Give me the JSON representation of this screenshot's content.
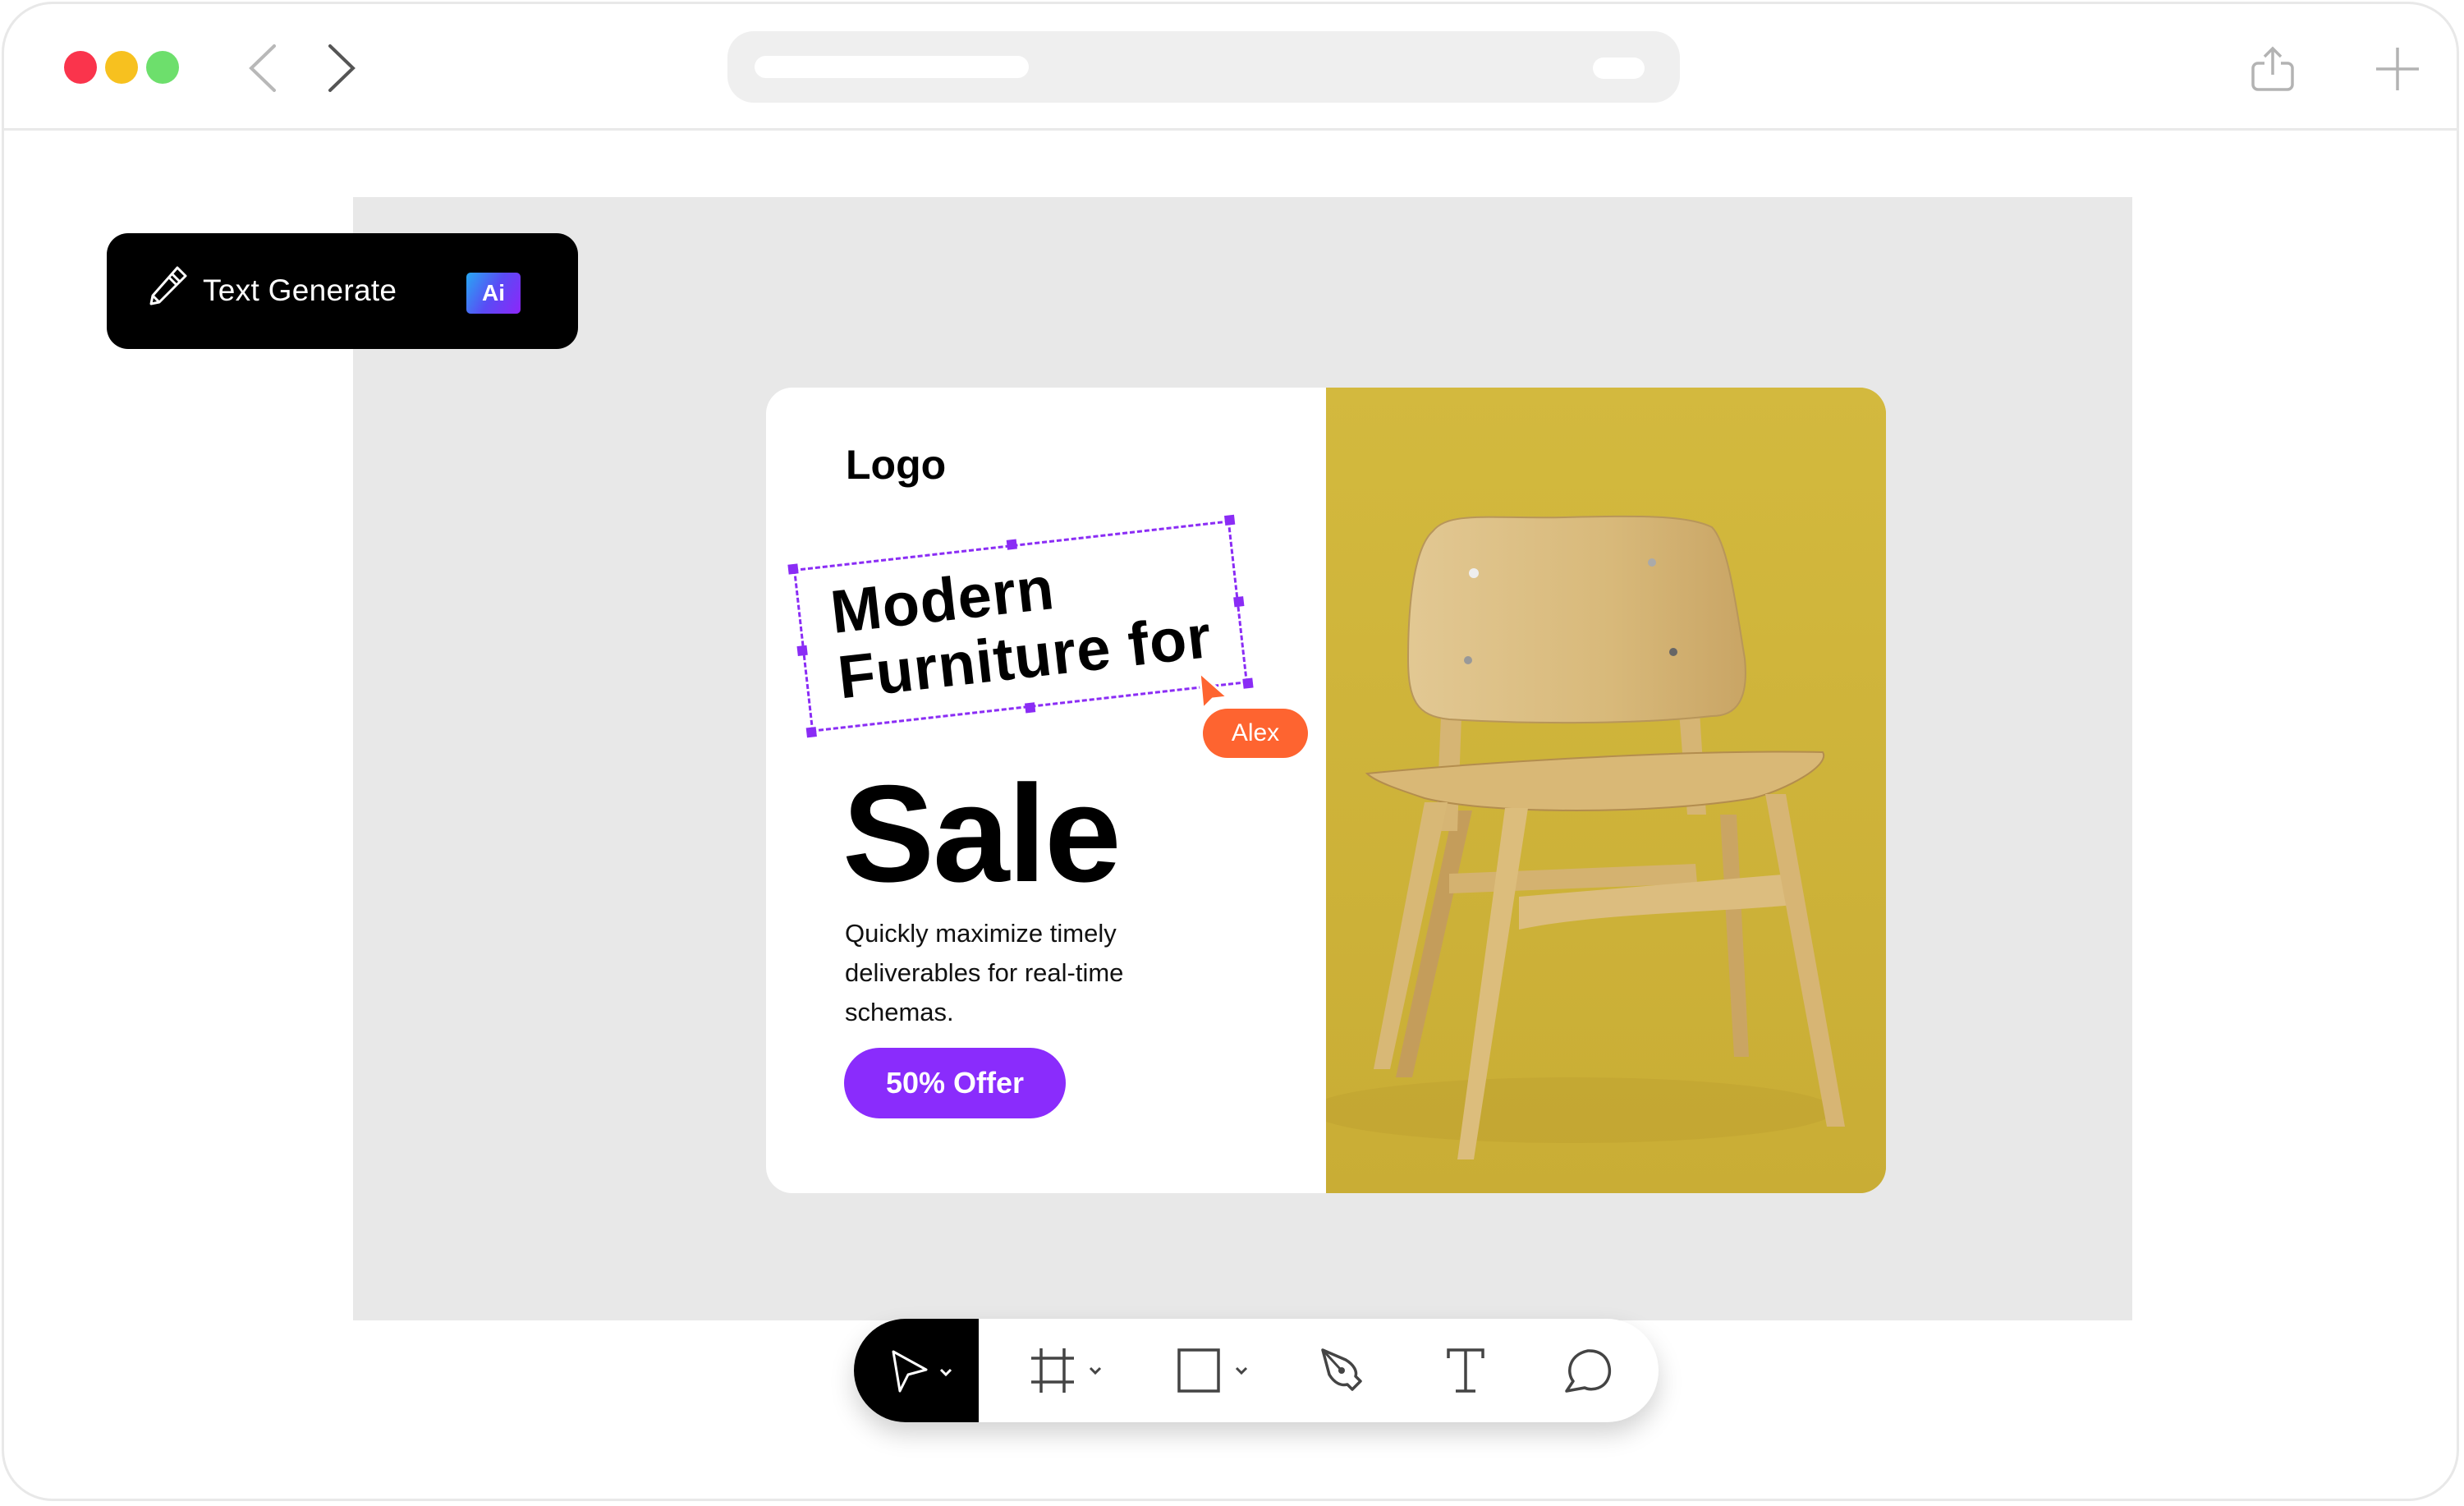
{
  "browser": {
    "traffic_lights": [
      "close",
      "minimize",
      "maximize"
    ],
    "nav": {
      "back_icon": "chevron-left-icon",
      "forward_icon": "chevron-right-icon"
    },
    "actions": [
      "share-icon",
      "new-tab-icon"
    ]
  },
  "ai_chip": {
    "icon": "pencil-icon",
    "label": "Text Generate",
    "badge": "Ai"
  },
  "design": {
    "logo": "Logo",
    "headline": "Modern\nFurniture for",
    "collaborator": "Alex",
    "title": "Sale",
    "body": "Quickly maximize timely deliverables for real-time schemas.",
    "cta": "50% Offer",
    "image": "wooden-chair-on-yellow-background"
  },
  "colors": {
    "selection": "#8a2cf5",
    "collaborator": "#fe6430",
    "cta": "#8a2cfc",
    "photo_bg": "#cfb63a"
  },
  "toolbar": {
    "tools": [
      {
        "name": "move",
        "icon": "pointer-icon",
        "active": true,
        "has_dropdown": true
      },
      {
        "name": "frame",
        "icon": "frame-icon",
        "active": false,
        "has_dropdown": true
      },
      {
        "name": "rectangle",
        "icon": "rectangle-icon",
        "active": false,
        "has_dropdown": true
      },
      {
        "name": "pen",
        "icon": "pen-icon",
        "active": false,
        "has_dropdown": false
      },
      {
        "name": "text",
        "icon": "text-icon",
        "active": false,
        "has_dropdown": false
      },
      {
        "name": "comment",
        "icon": "comment-icon",
        "active": false,
        "has_dropdown": false
      }
    ]
  }
}
